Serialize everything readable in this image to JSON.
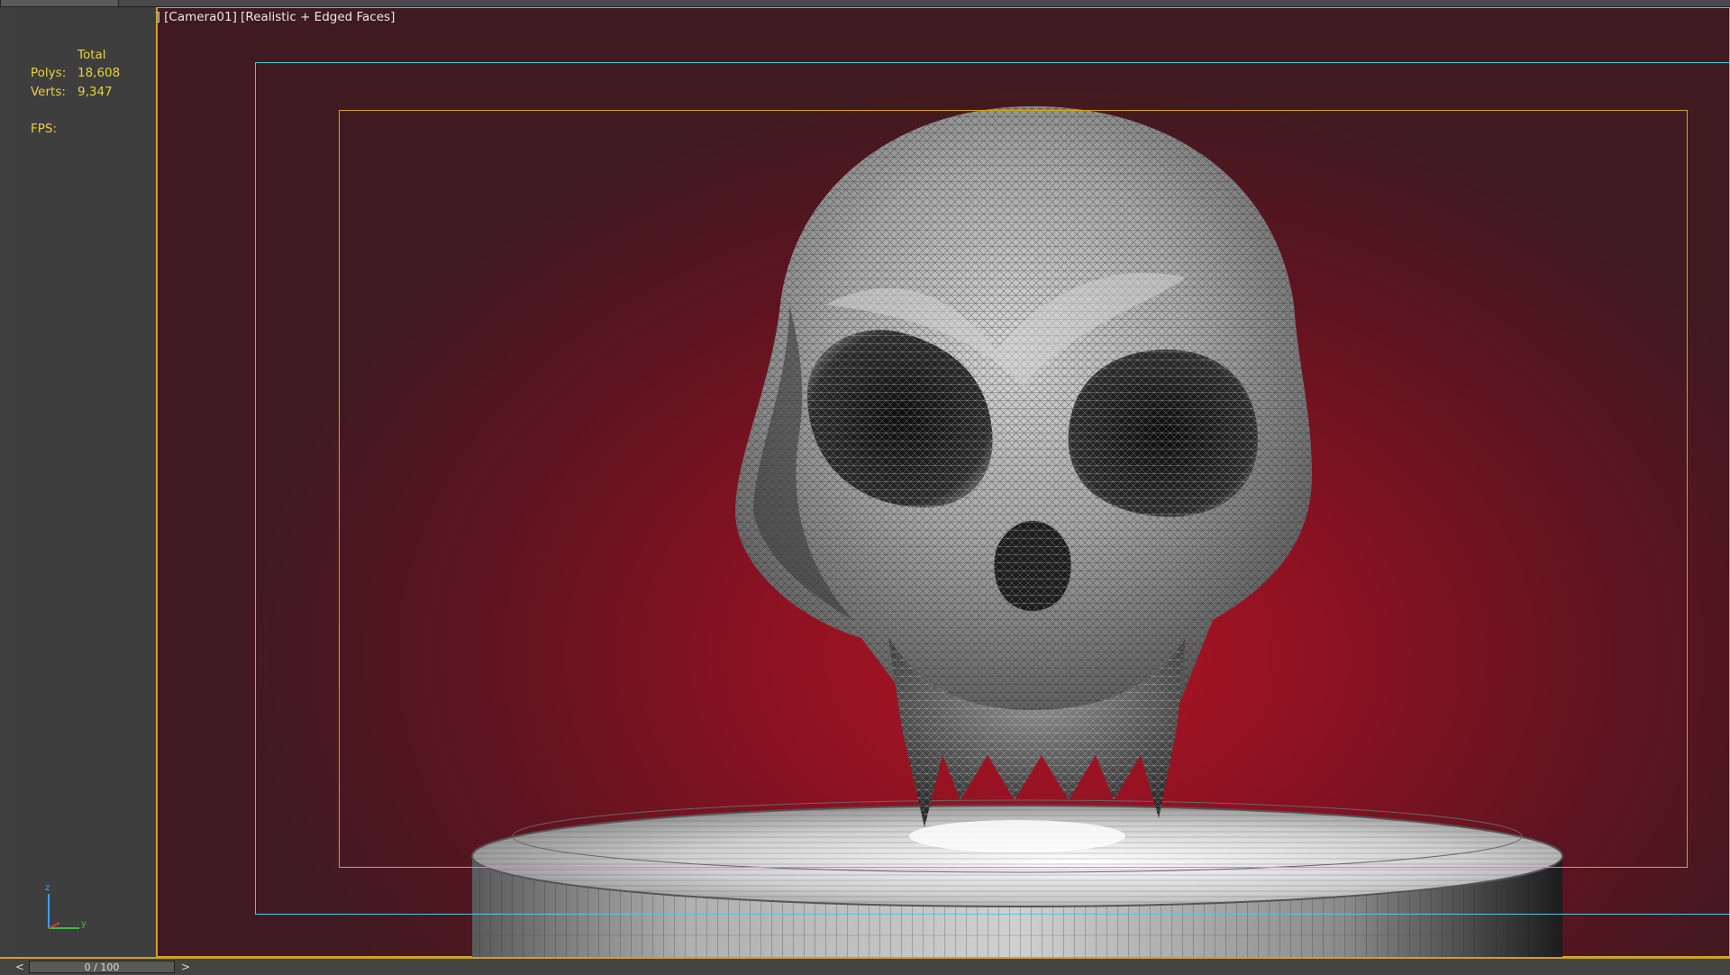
{
  "viewport": {
    "plus_label": "[+]",
    "camera_label": "[Camera01]",
    "shading_label": "[Realistic + Edged Faces]"
  },
  "stats": {
    "total_label": "Total",
    "polys_label": "Polys:",
    "polys_value": "18,608",
    "verts_label": "Verts:",
    "verts_value": "9,347",
    "fps_label": "FPS:"
  },
  "axis": {
    "z": "z",
    "y": "y"
  },
  "timeline": {
    "frame_text": "0 / 100",
    "prev_icon": "<",
    "next_icon": ">"
  },
  "colors": {
    "stats_text": "#ead13a",
    "live_safe_frame": "#4ec9d9",
    "action_safe_frame": "#d6a11e",
    "background_center": "#b01525",
    "background_edge": "#3f1a20"
  }
}
